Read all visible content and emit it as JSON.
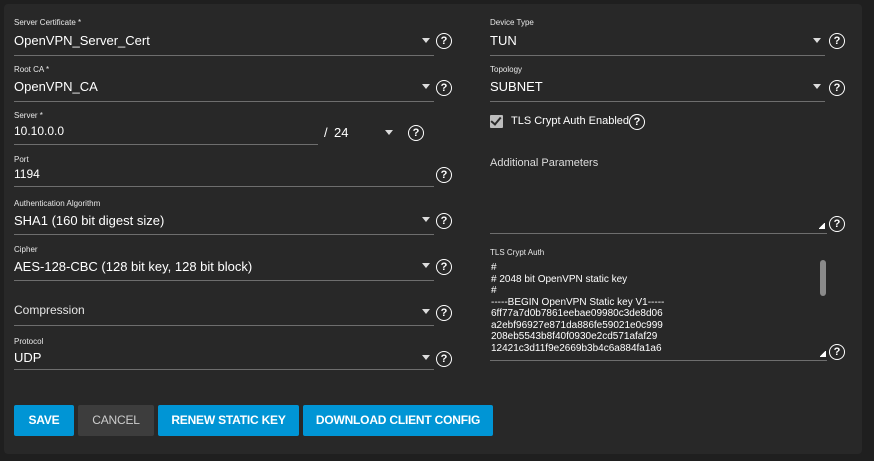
{
  "form": {
    "server_certificate": {
      "label": "Server Certificate *",
      "value": "OpenVPN_Server_Cert"
    },
    "root_ca": {
      "label": "Root CA *",
      "value": "OpenVPN_CA"
    },
    "server": {
      "label": "Server *",
      "value": "10.10.0.0",
      "separator": "/",
      "netmask": "24"
    },
    "port": {
      "label": "Port",
      "value": "1194"
    },
    "auth_algorithm": {
      "label": "Authentication Algorithm",
      "value": "SHA1 (160 bit digest size)"
    },
    "cipher": {
      "label": "Cipher",
      "value": "AES-128-CBC (128 bit key, 128 bit block)"
    },
    "compression": {
      "placeholder": "Compression"
    },
    "protocol": {
      "label": "Protocol",
      "value": "UDP"
    },
    "device_type": {
      "label": "Device Type",
      "value": "TUN"
    },
    "topology": {
      "label": "Topology",
      "value": "SUBNET"
    },
    "tls_crypt_auth_enabled": {
      "label": "TLS Crypt Auth Enabled",
      "checked": true
    },
    "additional_parameters": {
      "label": "Additional Parameters",
      "value": ""
    },
    "tls_crypt_auth": {
      "label": "TLS Crypt Auth",
      "value": "#\n# 2048 bit OpenVPN static key\n#\n-----BEGIN OpenVPN Static key V1-----\n6ff77a7d0b7861eebae09980c3de8d06\na2ebf96927e871da886fe59021e0c999\n208eb5543b8f40f0930e2cd571afaf29\n12421c3d11f9e2669b3b4c6a884fa1a6"
    }
  },
  "buttons": {
    "save": "SAVE",
    "cancel": "CANCEL",
    "renew": "RENEW STATIC KEY",
    "download": "DOWNLOAD CLIENT CONFIG"
  },
  "icons": {
    "help": "?"
  },
  "colors": {
    "primary": "#0095d5",
    "background": "#282828"
  }
}
